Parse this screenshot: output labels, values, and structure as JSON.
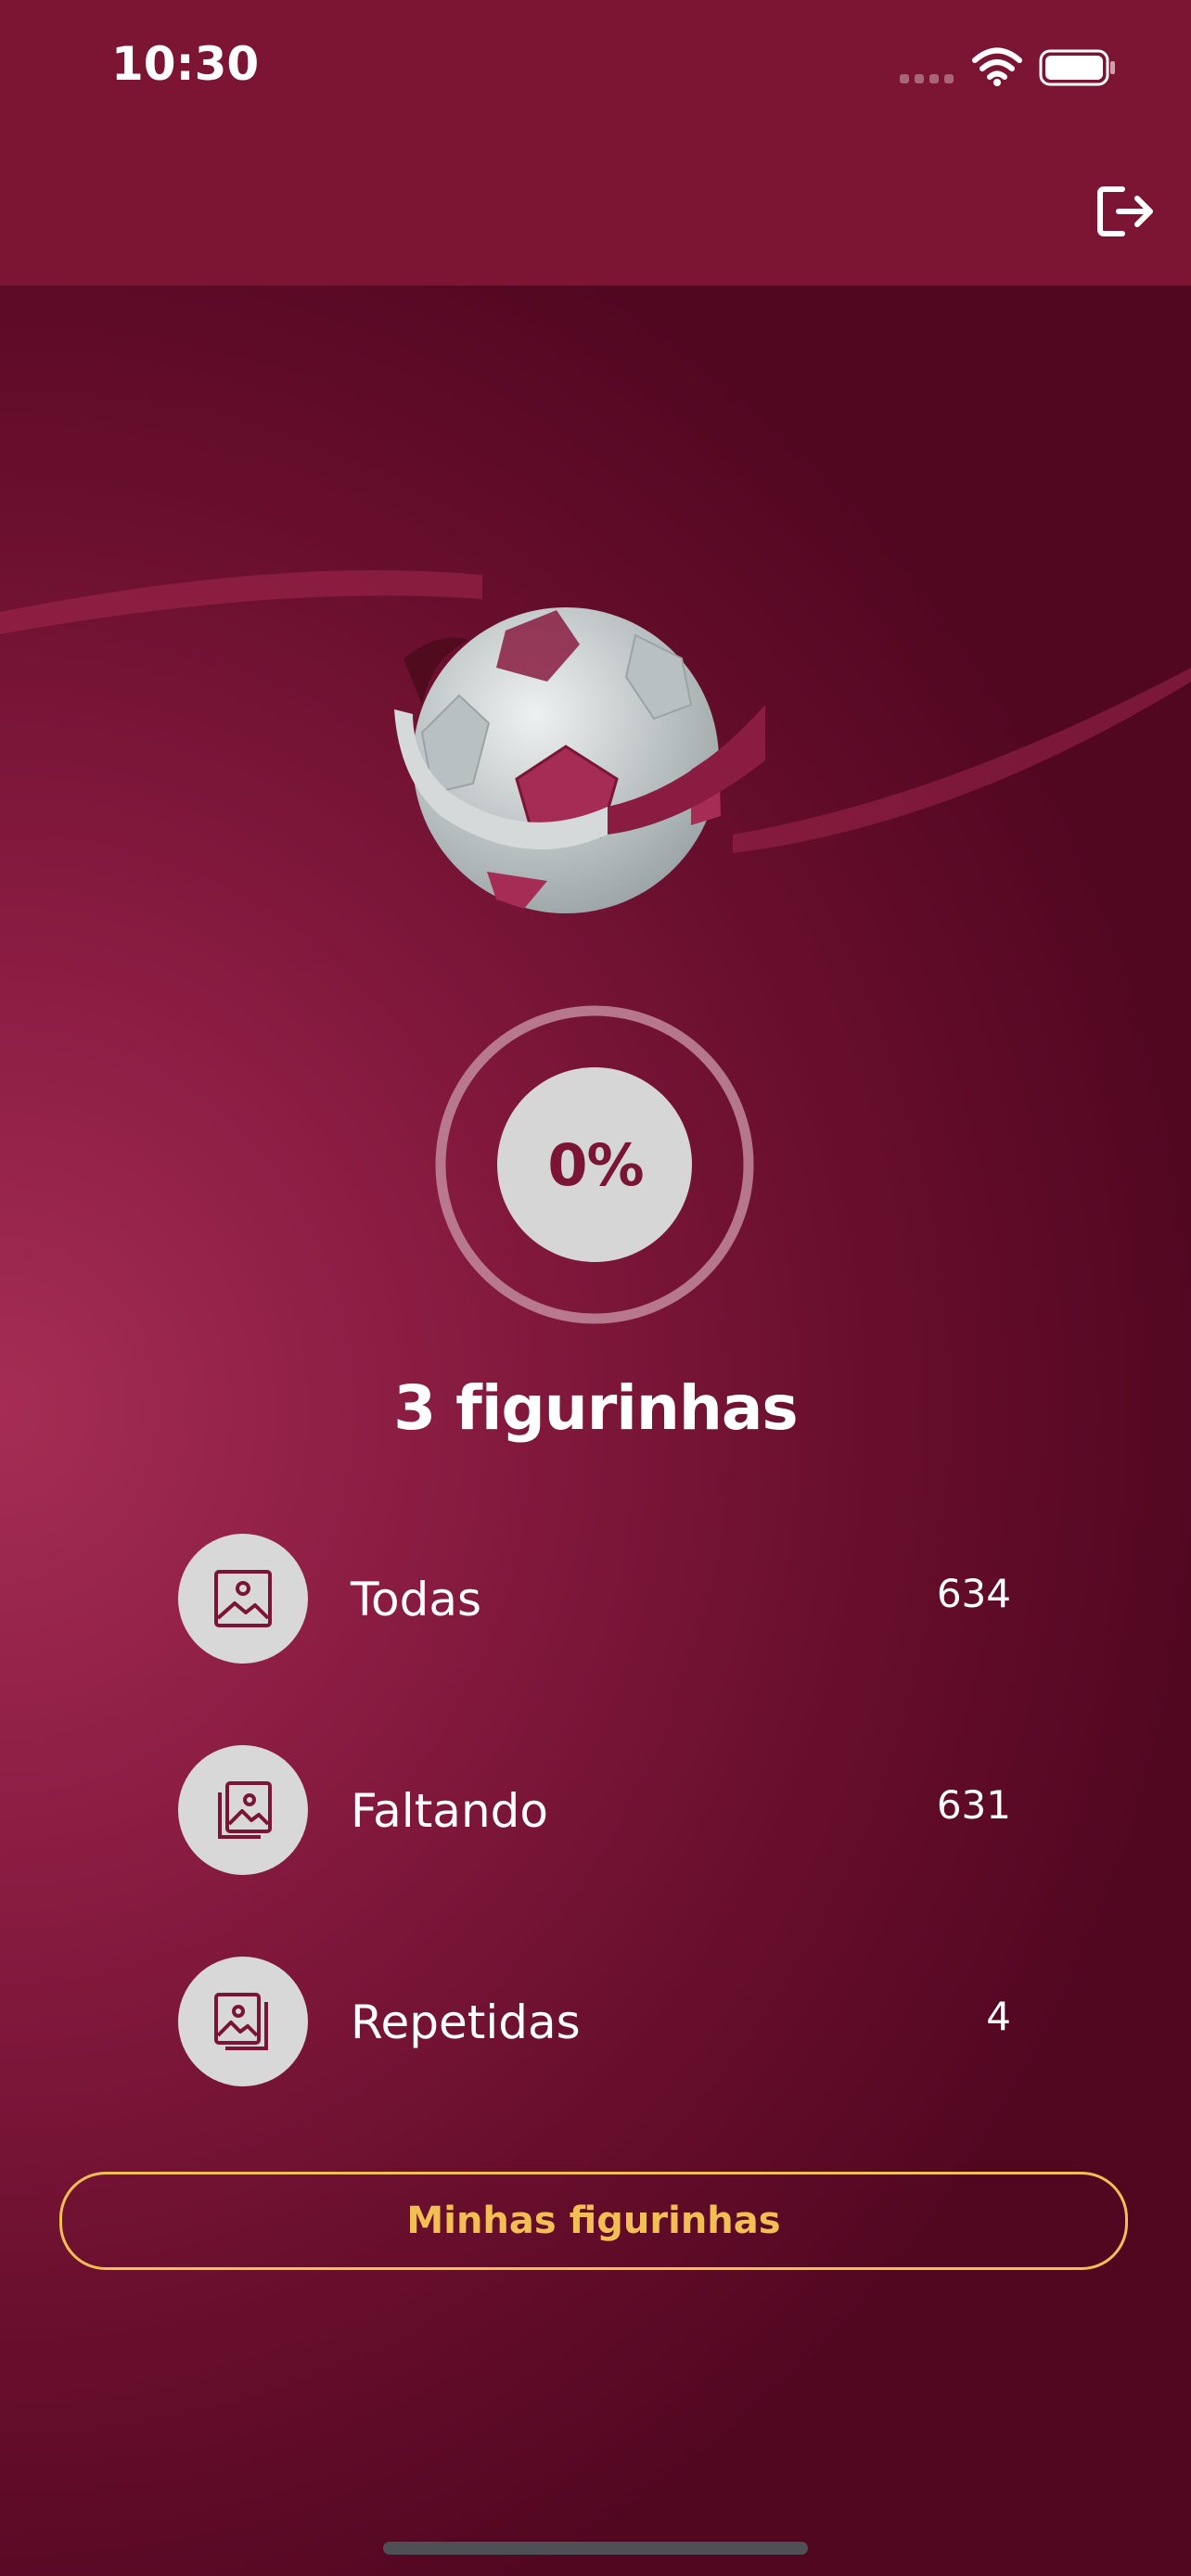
{
  "status_bar": {
    "time": "10:30"
  },
  "app_bar": {
    "logout_icon": "logout-icon"
  },
  "progress": {
    "percent_label": "0%",
    "value": 0
  },
  "summary": {
    "title": "3 figurinhas"
  },
  "stats": [
    {
      "label": "Todas",
      "value": "634",
      "icon": "image-icon"
    },
    {
      "label": "Faltando",
      "value": "631",
      "icon": "images-stack-icon"
    },
    {
      "label": "Repetidas",
      "value": "4",
      "icon": "images-duplicate-icon"
    }
  ],
  "actions": {
    "my_stickers": "Minhas figurinhas"
  },
  "colors": {
    "primary": "#7c1434",
    "accent": "#f3be54",
    "icon_bg": "#d8d8d8"
  }
}
